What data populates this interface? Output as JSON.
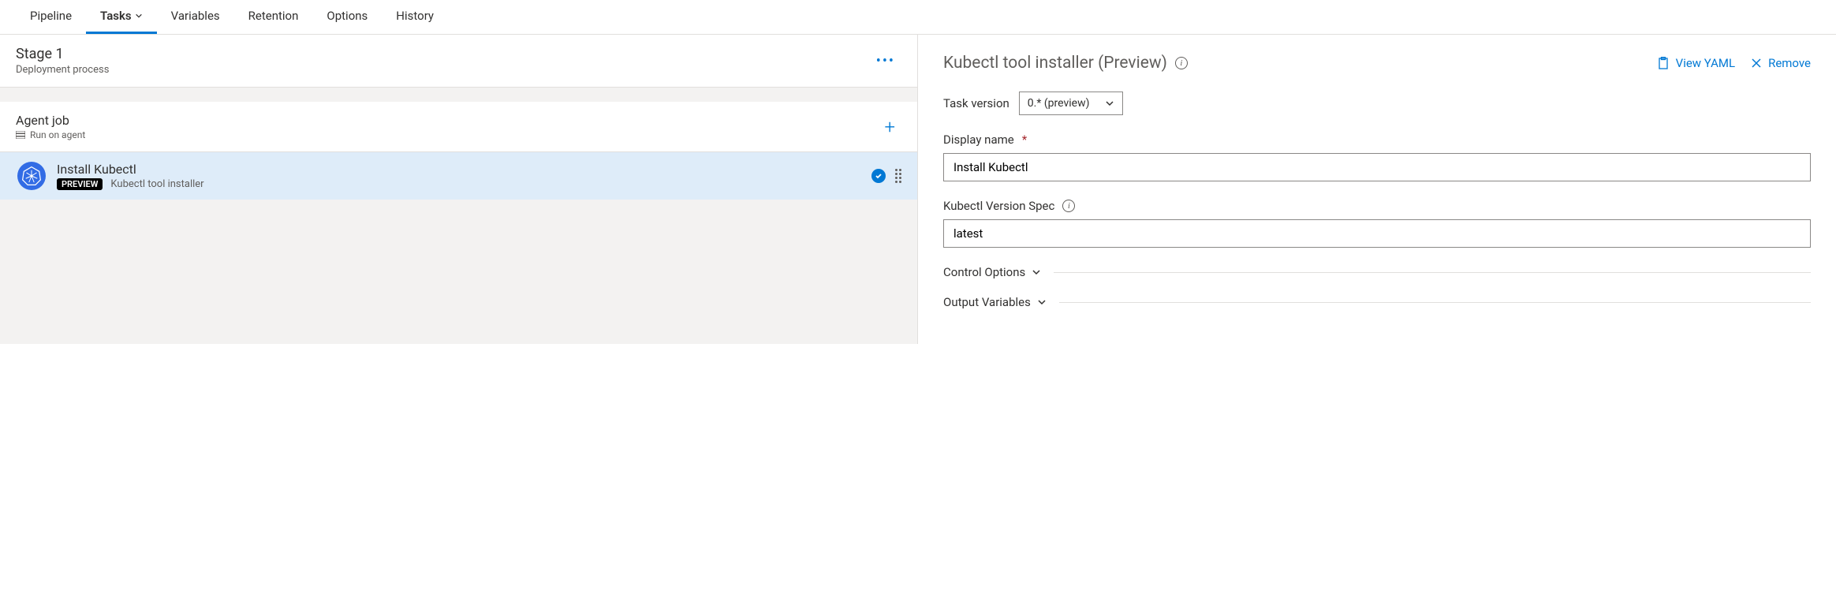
{
  "tabs": {
    "pipeline": "Pipeline",
    "tasks": "Tasks",
    "variables": "Variables",
    "retention": "Retention",
    "options": "Options",
    "history": "History"
  },
  "stage": {
    "title": "Stage 1",
    "subtitle": "Deployment process"
  },
  "job": {
    "title": "Agent job",
    "subtitle": "Run on agent"
  },
  "task": {
    "title": "Install Kubectl",
    "preview_badge": "PREVIEW",
    "description": "Kubectl tool installer"
  },
  "panel": {
    "title": "Kubectl tool installer (Preview)",
    "view_yaml": "View YAML",
    "remove": "Remove",
    "task_version_label": "Task version",
    "task_version_value": "0.* (preview)",
    "display_name_label": "Display name",
    "display_name_value": "Install Kubectl",
    "version_spec_label": "Kubectl Version Spec",
    "version_spec_value": "latest",
    "control_options": "Control Options",
    "output_variables": "Output Variables"
  }
}
